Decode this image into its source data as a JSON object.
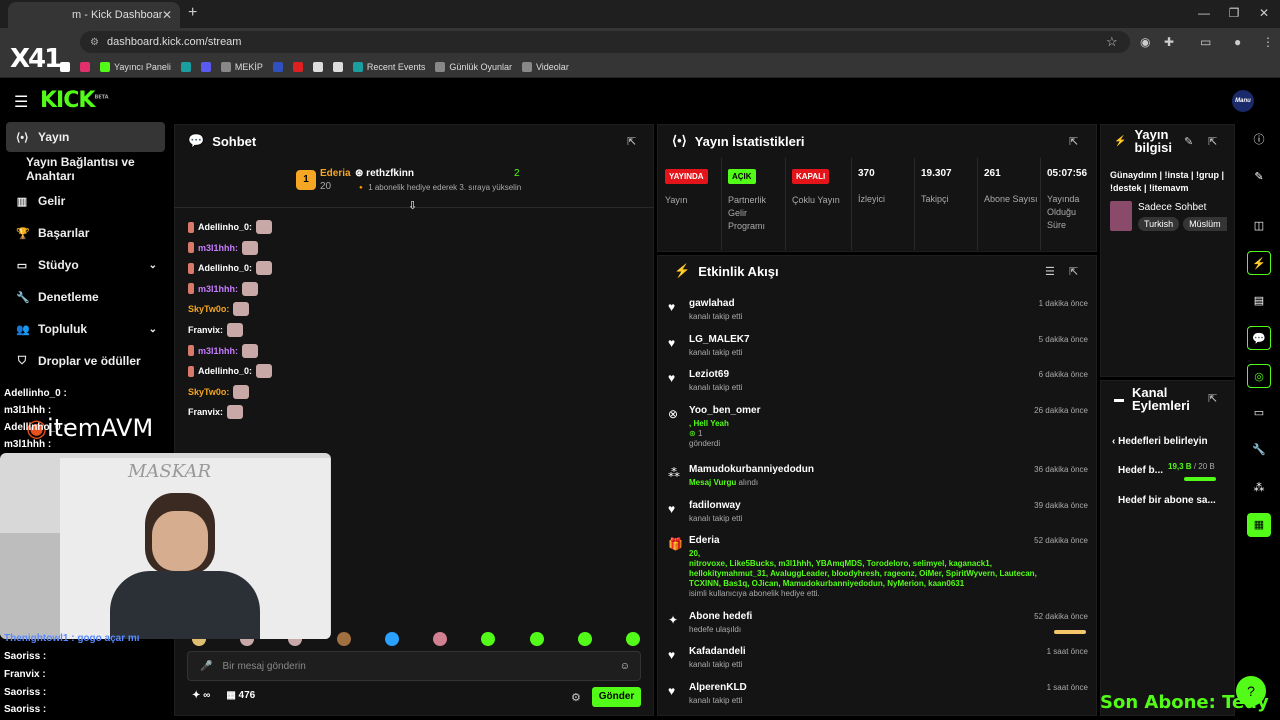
{
  "browser": {
    "tab_title": "m - Kick Dashboard",
    "url": "dashboard.kick.com/stream",
    "bookmarks": [
      {
        "label": "",
        "color": "#ffffff"
      },
      {
        "label": "",
        "color": "#e1306c"
      },
      {
        "label": "Yayıncı Paneli",
        "color": "#53fc18"
      },
      {
        "label": "",
        "color": "#1a9fa0"
      },
      {
        "label": "",
        "color": "#5a5af0"
      },
      {
        "label": "MEKİP",
        "color": "#888888"
      },
      {
        "label": "",
        "color": "#3050c0"
      },
      {
        "label": "",
        "color": "#e02020"
      },
      {
        "label": "",
        "color": "#dddddd"
      },
      {
        "label": "",
        "color": "#dddddd"
      },
      {
        "label": "Recent Events",
        "color": "#1a9fa0"
      },
      {
        "label": "Günlük Oyunlar",
        "color": "#888888"
      },
      {
        "label": "Videolar",
        "color": "#888888"
      }
    ]
  },
  "app": {
    "logo": "KICK",
    "logo_sup": "BETA",
    "user_avatar": "Manu"
  },
  "sidebar": {
    "items": [
      {
        "label": "Yayın",
        "icon": "broadcast-icon",
        "active": true
      },
      {
        "label": "Yayın Bağlantısı ve Anahtarı",
        "icon": "",
        "active": false
      },
      {
        "label": "Gelir",
        "icon": "chart-icon",
        "active": false
      },
      {
        "label": "Başarılar",
        "icon": "trophy-icon",
        "active": false
      },
      {
        "label": "Stüdyo",
        "icon": "studio-icon",
        "active": false,
        "chevron": true
      },
      {
        "label": "Denetleme",
        "icon": "wrench-icon",
        "active": false
      },
      {
        "label": "Topluluk",
        "icon": "people-icon",
        "active": false,
        "chevron": true
      },
      {
        "label": "Droplar ve ödüller",
        "icon": "gift-icon",
        "active": false
      }
    ]
  },
  "chat": {
    "title": "Sohbet",
    "pinned": {
      "rank": "1",
      "user": "Ederia",
      "count": "20",
      "gifter": "rethzfkinn",
      "gifter_count": "2",
      "note": "1 abonelik hediye ederek 3. sıraya yükselin"
    },
    "messages": [
      {
        "user": "Adellinho_0:",
        "color": "#ffffff"
      },
      {
        "user": "m3l1hhh:",
        "color": "#c77dff"
      },
      {
        "user": "Adellinho_0:",
        "color": "#ffffff"
      },
      {
        "user": "m3l1hhh:",
        "color": "#c77dff"
      },
      {
        "user": "SkyTw0o:",
        "color": "#f5a623"
      },
      {
        "user": "Franvix:",
        "color": "#ffffff"
      },
      {
        "user": "m3l1hhh:",
        "color": "#c77dff"
      },
      {
        "user": "Adellinho_0:",
        "color": "#ffffff"
      },
      {
        "user": "SkyTw0o:",
        "color": "#f5a623"
      },
      {
        "user": "Franvix:",
        "color": "#ffffff"
      }
    ],
    "input_placeholder": "Bir mesaj gönderin",
    "send_label": "Gönder",
    "footer_points": "∞",
    "footer_count": "476"
  },
  "stats": {
    "title": "Yayın İstatistikleri",
    "items": [
      {
        "pill": "YAYINDA",
        "pill_color": "#e3151a",
        "label": "Yayın"
      },
      {
        "pill": "AÇIK",
        "pill_color": "#53fc18",
        "label": "Partnerlik Gelir Programı"
      },
      {
        "pill": "KAPALI",
        "pill_color": "#e3151a",
        "label": "Çoklu Yayın"
      },
      {
        "num": "370",
        "label": "İzleyici"
      },
      {
        "num": "19.307",
        "label": "Takipçi"
      },
      {
        "num": "261",
        "label": "Abone Sayısı"
      },
      {
        "num": "05:07:56",
        "label": "Yayında Olduğu Süre"
      }
    ]
  },
  "events": {
    "title": "Etkinlik Akışı",
    "items": [
      {
        "name": "gawlahad",
        "sub": "kanalı takip etti",
        "time": "1 dakika önce"
      },
      {
        "name": "LG_MALEK7",
        "sub": "kanalı takip etti",
        "time": "5 dakika önce"
      },
      {
        "name": "Leziot69",
        "sub": "kanalı takip etti",
        "time": "6 dakika önce"
      },
      {
        "name": "Yoo_ben_omer",
        "sub1": ", Hell Yeah",
        "sub2": "1",
        "sub3": "gönderdi",
        "time": "26 dakika önce"
      },
      {
        "name": "Mamudokurbanniyedodun",
        "sub_green": "Mesaj Vurgu",
        "sub": "alındı",
        "time": "36 dakika önce"
      },
      {
        "name": "fadilonway",
        "sub": "kanalı takip etti",
        "time": "39 dakika önce"
      },
      {
        "name": "Ederia",
        "count": "20,",
        "list": "nitrovoxe, Like5Bucks, m3l1hhh, YBAmqMDS, Torodeloro, selimyel, kaganack1, hellokitymahmut_31, AvaluggLeader, bloodyhresh, rageonz, OiMer, SpiritWyvern, Lautecan, TCXINN, Bas1q, OJican, Mamudokurbanniyedodun, NyMerion, kaan0631",
        "sub": "isimli kullanıcıya abonelik hediye etti.",
        "time": "52 dakika önce"
      },
      {
        "name": "Abone hedefi",
        "sub": "hedefe ulaşıldı",
        "time": "52 dakika önce"
      },
      {
        "name": "Kafadandeli",
        "sub": "kanalı takip etti",
        "time": "1 saat önce"
      },
      {
        "name": "AlperenKLD",
        "sub": "kanalı takip etti",
        "time": "1 saat önce"
      }
    ]
  },
  "info": {
    "title": "Yayın bilgisi",
    "stream_title": "Günaydınn | !insta | !grup | !destek | !itemavm",
    "category": "Sadece Sohbet",
    "tags": [
      "Turkish",
      "Müslüm"
    ]
  },
  "actions": {
    "title": "Kanal Eylemleri",
    "back": "Hedefleri belirleyin",
    "goal1": "Hedef b...",
    "goal1_value": "19,3 B",
    "goal1_target": "/ 20 B",
    "goal2": "Hedef bir abone sa..."
  },
  "overlay": {
    "x41": "X41",
    "brand": "itemAVM",
    "cam_label": "MASKAR",
    "son_abone": "Son Abone: Tedy",
    "left_chat": [
      {
        "user": "Adellinho_0 :"
      },
      {
        "user": "m3l1hhh :"
      },
      {
        "user": "Adellinho_0 :"
      },
      {
        "user": "m3l1hhh :"
      },
      {
        "user": "Thenightowl1 : gogo açar mı"
      },
      {
        "user": "Saoriss :"
      },
      {
        "user": "Franvix :"
      },
      {
        "user": "Saoriss :"
      },
      {
        "user": "Saoriss :"
      }
    ]
  }
}
